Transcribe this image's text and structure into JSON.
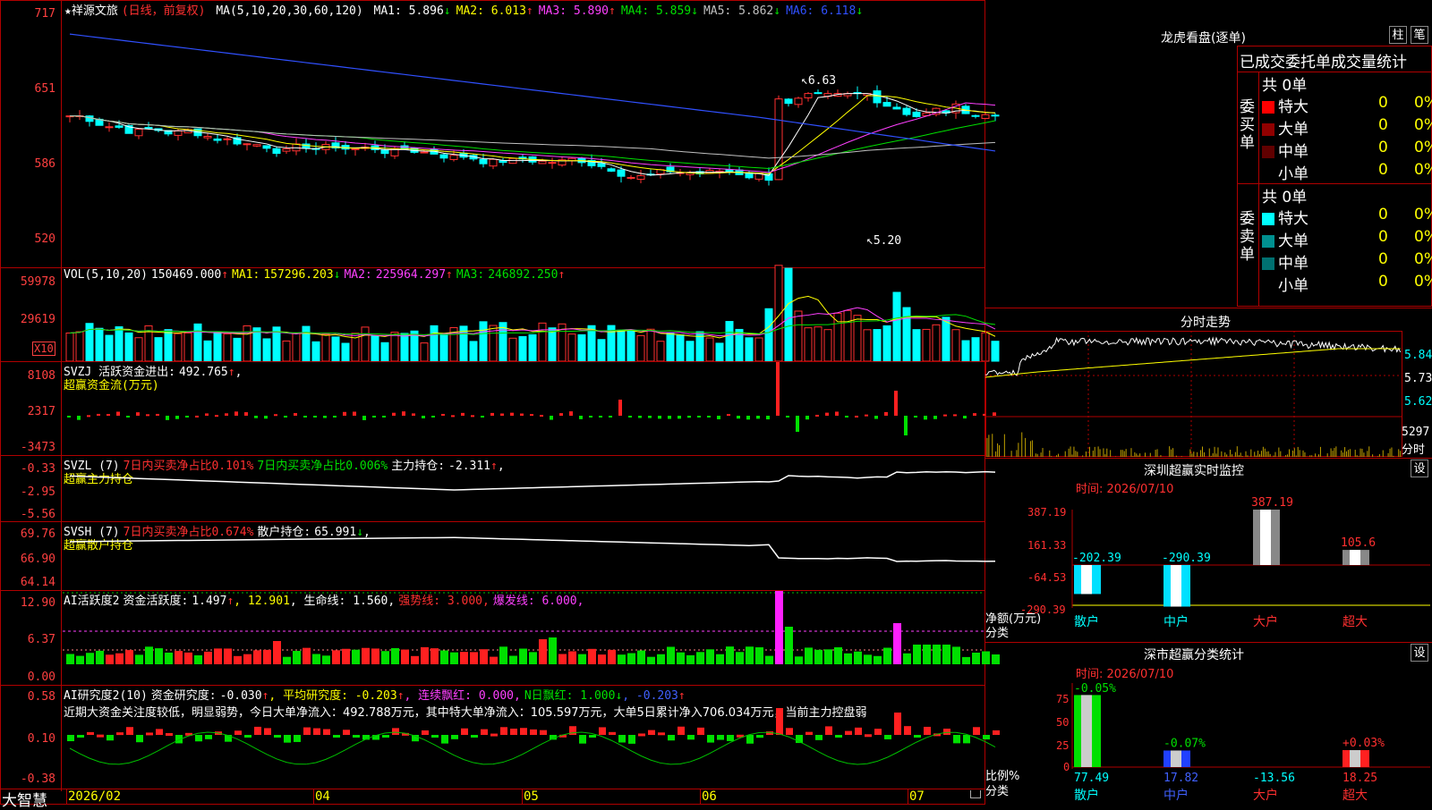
{
  "stock": {
    "name": "★祥源文旅",
    "period": "(日线，前复权)",
    "ma_header": "MA(5,10,20,30,60,120)",
    "ma": [
      {
        "label": "MA1:",
        "value": "5.896",
        "arrow": "↓",
        "color": "#ffffff"
      },
      {
        "label": "MA2:",
        "value": "6.013",
        "arrow": "↑",
        "color": "#ffff00"
      },
      {
        "label": "MA3:",
        "value": "5.890",
        "arrow": "↑",
        "color": "#ff40ff"
      },
      {
        "label": "MA4:",
        "value": "5.859",
        "arrow": "↓",
        "color": "#00e000"
      },
      {
        "label": "MA5:",
        "value": "5.862",
        "arrow": "↓",
        "color": "#c0c0c0"
      },
      {
        "label": "MA6:",
        "value": "6.118",
        "arrow": "↓",
        "color": "#3050ff"
      }
    ],
    "y_labels": [
      "717",
      "651",
      "586",
      "520"
    ],
    "high_mark": "6.63",
    "low_mark": "5.20"
  },
  "vol": {
    "header": "VOL(5,10,20)",
    "value": "150469.000",
    "value_arrow": "↑",
    "ma1_label": "MA1:",
    "ma1": "157296.203",
    "ma1_arrow": "↓",
    "ma2_label": "MA2:",
    "ma2": "225964.297",
    "ma2_arrow": "↑",
    "ma3_label": "MA3:",
    "ma3": "246892.250",
    "ma3_arrow": "↑",
    "y_labels": [
      "59978",
      "29619"
    ],
    "unit": "X10"
  },
  "svzj": {
    "line1_label": "SVZJ  活跃资金进出:",
    "line1_value": "492.765",
    "line1_arrow": "↑",
    "line1_suffix": ",",
    "line2": "超赢资金流(万元)",
    "y_labels": [
      "8108",
      "2317",
      "-3473"
    ]
  },
  "svzl": {
    "prefix": "SVZL (7)",
    "t1": "7日内买卖净占比0.101%",
    "t2": "7日内买卖净占比0.006%",
    "t3_label": "主力持仓:",
    "t3_value": "-2.311",
    "t3_arrow": "↑",
    "t3_suffix": ",",
    "line2": "超赢主力持仓",
    "y_labels": [
      "-0.33",
      "-2.95",
      "-5.56"
    ]
  },
  "svsh": {
    "prefix": "SVSH (7)",
    "t1": "7日内买卖净占比0.674%",
    "t2_label": "散户持仓:",
    "t2_value": "65.991",
    "t2_arrow": "↓",
    "t2_suffix": ",",
    "line2": "超赢散户持仓",
    "y_labels": [
      "69.76",
      "66.90",
      "64.14"
    ]
  },
  "ai1": {
    "prefix": "AI活跃度2",
    "t1_label": "资金活跃度:",
    "t1_value": "1.497",
    "t1_arrow": "↑",
    "t2": ", 12.901",
    "t3": ", 生命线: 1.560,",
    "t4": "强势线: 3.000,",
    "t5": "爆发线: 6.000,",
    "y_labels": [
      "12.90",
      "6.37",
      "0.00"
    ]
  },
  "ai2": {
    "prefix": "AI研究度2(10)",
    "t1_label": "资金研究度:",
    "t1_value": "-0.030",
    "t1_arrow": "↑",
    "t2": ", 平均研究度: -0.203",
    "t2_arrow": "↑",
    "t3": ", 连续飘红: 0.000,",
    "t4": "N日飘红: 1.000",
    "t4_arrow": "↓",
    "t5": ", -0.203",
    "t5_arrow": "↑",
    "comment": "近期大资金关注度较低，明显弱势，今日大单净流入：492.788万元，其中特大单净流入：105.597万元，大单5日累计净入706.034万元，当前主力控盘弱",
    "y_labels": [
      "0.58",
      "0.10",
      "-0.38"
    ]
  },
  "bottom": {
    "brand": "大智慧",
    "dates": [
      "2026/02",
      "04",
      "05",
      "06",
      "07"
    ]
  },
  "right": {
    "lhb_title": "龙虎看盘(逐单)",
    "btn_bar": "柱",
    "btn_pen": "笔",
    "stat_header": "已成交委托单成交量统计",
    "buy_side": "委买单",
    "sell_side": "委卖单",
    "buy_total": "共 0单",
    "sell_total": "共 0单",
    "buy_rows": [
      {
        "label": "特大",
        "value": "0",
        "pct": "0%",
        "color": "#ff0000"
      },
      {
        "label": "大单",
        "value": "0",
        "pct": "0%",
        "color": "#900000"
      },
      {
        "label": "中单",
        "value": "0",
        "pct": "0%",
        "color": "#600000"
      },
      {
        "label": "小单",
        "value": "0",
        "pct": "0%",
        "color": "#000000"
      }
    ],
    "sell_rows": [
      {
        "label": "特大",
        "value": "0",
        "pct": "0%",
        "color": "#00ffff"
      },
      {
        "label": "大单",
        "value": "0",
        "pct": "0%",
        "color": "#009090"
      },
      {
        "label": "中单",
        "value": "0",
        "pct": "0%",
        "color": "#007070"
      },
      {
        "label": "小单",
        "value": "0",
        "pct": "0%",
        "color": "#000000"
      }
    ],
    "intraday_title": "分时走势",
    "intraday_y": [
      "5.84",
      "5.73",
      "5.62"
    ],
    "intraday_vol": "5297",
    "intraday_unit": "分时",
    "sz_title": "深圳超赢实时监控",
    "sz_btn": "设",
    "sz_time": "时间: 2026/07/10",
    "sz_y": [
      "387.19",
      "161.33",
      "-64.53",
      "-290.39"
    ],
    "sz_ylabel": "净额(万元)",
    "sz_xlabel": "分类",
    "sz_bars": [
      {
        "cat": "散户",
        "value": -202.39,
        "label": "-202.39"
      },
      {
        "cat": "中户",
        "value": -290.39,
        "label": "-290.39"
      },
      {
        "cat": "大户",
        "value": 387.19,
        "label": "387.19"
      },
      {
        "cat": "超大",
        "value": 105.6,
        "label": "105.6"
      }
    ],
    "ss_title": "深市超赢分类统计",
    "ss_btn": "设",
    "ss_time": "时间: 2026/07/10",
    "ss_y": [
      "75",
      "50",
      "25",
      "0"
    ],
    "ss_ylabel": "比例%",
    "ss_xlabel": "分类",
    "ss_bars": [
      {
        "cat": "散户",
        "value": 77.49,
        "label": "77.49",
        "delta": "-0.05%"
      },
      {
        "cat": "中户",
        "value": 17.82,
        "label": "17.82",
        "delta": "-0.07%"
      },
      {
        "cat": "大户",
        "value": -13.56,
        "label": "-13.56",
        "delta": ""
      },
      {
        "cat": "超大",
        "value": 18.25,
        "label": "18.25",
        "delta": "+0.03%"
      }
    ]
  }
}
